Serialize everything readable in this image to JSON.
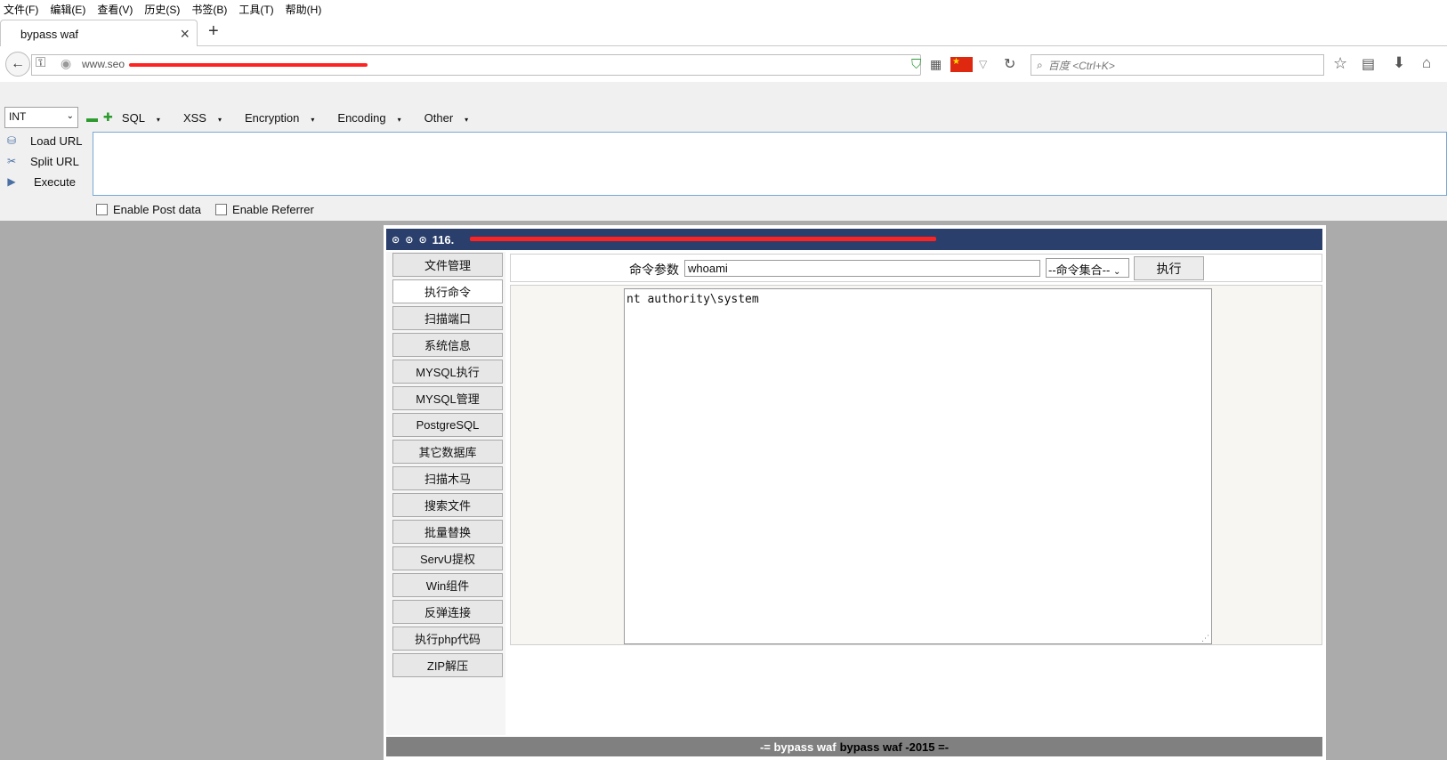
{
  "menubar": {
    "items": [
      "文件(F)",
      "编辑(E)",
      "查看(V)",
      "历史(S)",
      "书签(B)",
      "工具(T)",
      "帮助(H)"
    ]
  },
  "tab": {
    "title": "bypass waf"
  },
  "urlbar": {
    "url": "www.seo"
  },
  "search": {
    "placeholder": "百度 <Ctrl+K>"
  },
  "hackbar": {
    "select_value": "INT",
    "menus": [
      "SQL",
      "XSS",
      "Encryption",
      "Encoding",
      "Other"
    ],
    "load_url": "Load URL",
    "split_url": "Split URL",
    "execute": "Execute",
    "enable_post": "Enable Post data",
    "enable_referrer": "Enable Referrer"
  },
  "shell": {
    "title": "116.",
    "nav": [
      "文件管理",
      "执行命令",
      "扫描端口",
      "系统信息",
      "MYSQL执行",
      "MYSQL管理",
      "PostgreSQL",
      "其它数据库",
      "扫描木马",
      "搜索文件",
      "批量替换",
      "ServU提权",
      "Win组件",
      "反弹连接",
      "执行php代码",
      "ZIP解压"
    ],
    "active_nav": "执行命令",
    "cmd_label": "命令参数",
    "cmd_value": "whoami",
    "cmd_set": "--命令集合--",
    "exec_label": "执行",
    "output": "nt authority\\system",
    "footer_prefix": "-= bypass waf",
    "footer_suffix": "bypass waf -2015 =-"
  }
}
